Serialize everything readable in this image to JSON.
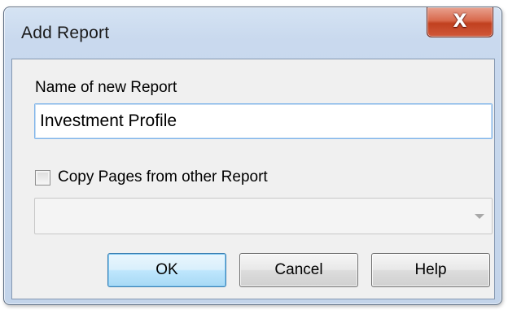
{
  "window": {
    "title": "Add Report",
    "close_glyph": "X"
  },
  "form": {
    "name_label": "Name of new Report",
    "name_value": "Investment Profile",
    "copy_label": "Copy Pages from other Report",
    "copy_checked": false,
    "report_select_value": ""
  },
  "buttons": {
    "ok": "OK",
    "cancel": "Cancel",
    "help": "Help"
  },
  "colors": {
    "frame": "#c9d9ee",
    "close_button": "#c74a2b",
    "default_button": "#bee6fd",
    "client": "#f0f0f0"
  }
}
